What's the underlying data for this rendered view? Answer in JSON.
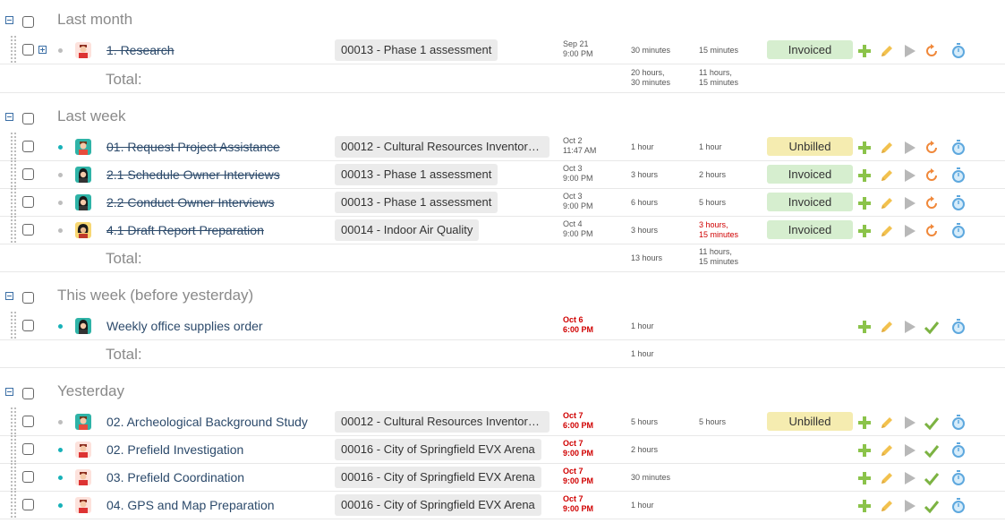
{
  "status_colors": {
    "invoiced": "#d6eecf",
    "unbilled": "#f5ecb0",
    "overdue": "#d00000"
  },
  "groups": [
    {
      "title": "Last month",
      "total_label": "Total:",
      "total_est": [
        "20 hours,",
        "30 minutes"
      ],
      "total_act": [
        "11 hours,",
        "15 minutes"
      ],
      "rows": [
        {
          "name": "1. Research",
          "project": "00013 - Phase 1 assessment",
          "date": [
            "Sep 21",
            "9:00 PM"
          ],
          "est": [
            "30 minutes"
          ],
          "act": [
            "15 minutes"
          ],
          "status": "Invoiced"
        }
      ]
    },
    {
      "title": "Last week",
      "total_label": "Total:",
      "total_est": [
        "13 hours"
      ],
      "total_act": [
        "11 hours,",
        "15 minutes"
      ],
      "rows": [
        {
          "name": "01. Request Project Assistance",
          "project": "00012 - Cultural Resources Inventory ...",
          "date": [
            "Oct 2",
            "11:47 AM"
          ],
          "est": [
            "1 hour"
          ],
          "act": [
            "1 hour"
          ],
          "status": "Unbilled"
        },
        {
          "name": "2.1 Schedule Owner Interviews",
          "project": "00013 - Phase 1 assessment",
          "date": [
            "Oct 3",
            "9:00 PM"
          ],
          "est": [
            "3 hours"
          ],
          "act": [
            "2 hours"
          ],
          "status": "Invoiced"
        },
        {
          "name": "2.2 Conduct Owner Interviews",
          "project": "00013 - Phase 1 assessment",
          "date": [
            "Oct 3",
            "9:00 PM"
          ],
          "est": [
            "6 hours"
          ],
          "act": [
            "5 hours"
          ],
          "status": "Invoiced"
        },
        {
          "name": "4.1 Draft Report Preparation",
          "project": "00014 - Indoor Air Quality",
          "date": [
            "Oct 4",
            "9:00 PM"
          ],
          "est": [
            "3 hours"
          ],
          "act": [
            "3 hours,",
            "15 minutes"
          ],
          "status": "Invoiced"
        }
      ]
    },
    {
      "title": "This week (before yesterday)",
      "total_label": "Total:",
      "total_est": [
        "1 hour"
      ],
      "total_act": [],
      "rows": [
        {
          "name": "Weekly office supplies order",
          "project": "",
          "date": [
            "Oct 6",
            "6:00 PM"
          ],
          "est": [
            "1 hour"
          ],
          "act": [],
          "status": ""
        }
      ]
    },
    {
      "title": "Yesterday",
      "rows": [
        {
          "name": "02. Archeological Background Study",
          "project": "00012 - Cultural Resources Inventory ...",
          "date": [
            "Oct 7",
            "6:00 PM"
          ],
          "est": [
            "5 hours"
          ],
          "act": [
            "5 hours"
          ],
          "status": "Unbilled"
        },
        {
          "name": "02. Prefield Investigation",
          "project": "00016 - City of Springfield EVX Arena",
          "date": [
            "Oct 7",
            "9:00 PM"
          ],
          "est": [
            "2 hours"
          ],
          "act": [],
          "status": ""
        },
        {
          "name": "03. Prefield Coordination",
          "project": "00016 - City of Springfield EVX Arena",
          "date": [
            "Oct 7",
            "9:00 PM"
          ],
          "est": [
            "30 minutes"
          ],
          "act": [],
          "status": ""
        },
        {
          "name": "04. GPS and Map Preparation",
          "project": "00016 - City of Springfield EVX Arena",
          "date": [
            "Oct 7",
            "9:00 PM"
          ],
          "est": [
            "1 hour"
          ],
          "act": [],
          "status": ""
        }
      ]
    }
  ]
}
